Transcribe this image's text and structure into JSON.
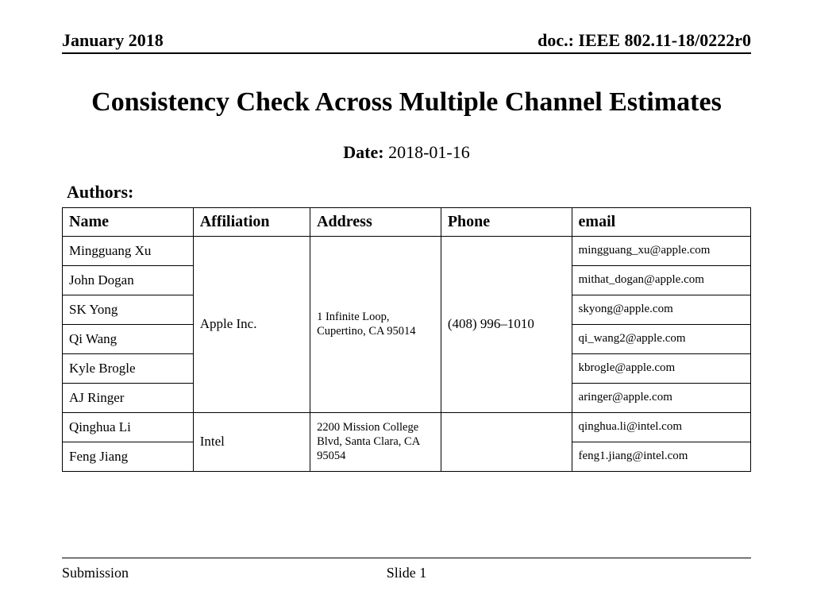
{
  "header": {
    "date_text": "January 2018",
    "doc_id": "doc.: IEEE 802.11-18/0222r0"
  },
  "title": "Consistency Check Across Multiple Channel Estimates",
  "date": {
    "label": "Date:",
    "value": "2018-01-16"
  },
  "authors_label": "Authors:",
  "table": {
    "headers": {
      "name": "Name",
      "affiliation": "Affiliation",
      "address": "Address",
      "phone": "Phone",
      "email": "email"
    },
    "groups": [
      {
        "affiliation": "Apple Inc.",
        "address": "1 Infinite Loop, Cupertino, CA 95014",
        "phone": "(408) 996–1010",
        "rows": [
          {
            "name": "Mingguang Xu",
            "email": "mingguang_xu@apple.com"
          },
          {
            "name": "John Dogan",
            "email": "mithat_dogan@apple.com"
          },
          {
            "name": "SK Yong",
            "email": "skyong@apple.com"
          },
          {
            "name": "Qi Wang",
            "email": "qi_wang2@apple.com"
          },
          {
            "name": "Kyle Brogle",
            "email": "kbrogle@apple.com"
          },
          {
            "name": "AJ Ringer",
            "email": "aringer@apple.com"
          }
        ]
      },
      {
        "affiliation": "Intel",
        "address": "2200 Mission College Blvd, Santa Clara, CA 95054",
        "phone": "",
        "rows": [
          {
            "name": "Qinghua Li",
            "email": "qinghua.li@intel.com"
          },
          {
            "name": "Feng Jiang",
            "email": "feng1.jiang@intel.com"
          }
        ]
      }
    ]
  },
  "footer": {
    "left": "Submission",
    "center": "Slide 1"
  }
}
